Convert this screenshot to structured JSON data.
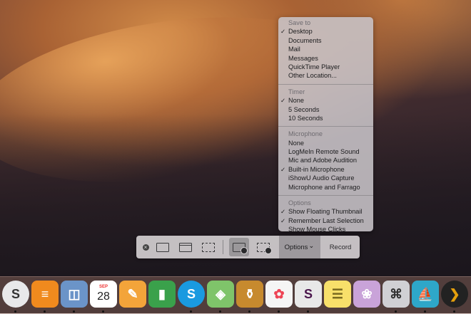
{
  "menu": {
    "sections": [
      {
        "header": "Save to",
        "items": [
          {
            "label": "Desktop",
            "checked": true
          },
          {
            "label": "Documents",
            "checked": false
          },
          {
            "label": "Mail",
            "checked": false
          },
          {
            "label": "Messages",
            "checked": false
          },
          {
            "label": "QuickTime Player",
            "checked": false
          },
          {
            "label": "Other Location...",
            "checked": false
          }
        ]
      },
      {
        "header": "Timer",
        "items": [
          {
            "label": "None",
            "checked": true
          },
          {
            "label": "5 Seconds",
            "checked": false
          },
          {
            "label": "10 Seconds",
            "checked": false
          }
        ]
      },
      {
        "header": "Microphone",
        "items": [
          {
            "label": "None",
            "checked": false
          },
          {
            "label": "LogMeIn Remote Sound",
            "checked": false
          },
          {
            "label": "Mic and Adobe Audition",
            "checked": false
          },
          {
            "label": "Built-in Microphone",
            "checked": true
          },
          {
            "label": "iShowU Audio Capture",
            "checked": false
          },
          {
            "label": "Microphone and Farrago",
            "checked": false
          }
        ]
      },
      {
        "header": "Options",
        "items": [
          {
            "label": "Show Floating Thumbnail",
            "checked": true
          },
          {
            "label": "Remember Last Selection",
            "checked": true
          },
          {
            "label": "Show Mouse Clicks",
            "checked": false
          }
        ]
      }
    ],
    "check_glyph": "✓"
  },
  "toolbar": {
    "close_glyph": "×",
    "options_label": "Options",
    "options_chevron": "⌄",
    "record_label": "Record"
  },
  "dock": {
    "apps": [
      {
        "name": "scrivener-icon",
        "glyph": "S",
        "color": "#e8e8ea",
        "fg": "#333",
        "dot": true
      },
      {
        "name": "omniplan-icon",
        "glyph": "≡",
        "color": "#f08a1e",
        "fg": "#fff",
        "dot": true
      },
      {
        "name": "preview-icon",
        "glyph": "◫",
        "color": "#6b94c8",
        "fg": "#fff",
        "dot": true
      },
      {
        "name": "calendar-icon",
        "glyph": "28",
        "color": "#ffffff",
        "fg": "#222",
        "dot": true,
        "month": "SEP"
      },
      {
        "name": "pages-icon",
        "glyph": "✎",
        "color": "#f3a43a",
        "fg": "#fff",
        "dot": false
      },
      {
        "name": "numbers-icon",
        "glyph": "▮",
        "color": "#3aa14b",
        "fg": "#fff",
        "dot": false
      },
      {
        "name": "skype-icon",
        "glyph": "S",
        "color": "#1a9ae0",
        "fg": "#fff",
        "dot": true
      },
      {
        "name": "maps-icon",
        "glyph": "◈",
        "color": "#7fc46a",
        "fg": "#fff",
        "dot": true
      },
      {
        "name": "jar-app-icon",
        "glyph": "⚱",
        "color": "#c78a2e",
        "fg": "#fff",
        "dot": true
      },
      {
        "name": "photos-icon",
        "glyph": "✿",
        "color": "#f5f5f5",
        "fg": "#e45",
        "dot": true
      },
      {
        "name": "slack-icon",
        "glyph": "S",
        "color": "#e8e8e8",
        "fg": "#4a154b",
        "dot": true
      },
      {
        "name": "notes-icon",
        "glyph": "☰",
        "color": "#f8e06a",
        "fg": "#7a6a20",
        "dot": false
      },
      {
        "name": "flower-app-icon",
        "glyph": "❀",
        "color": "#c9a3d9",
        "fg": "#fff",
        "dot": false
      },
      {
        "name": "system-tools-icon",
        "glyph": "⌘",
        "color": "#d0d0d4",
        "fg": "#333",
        "dot": true
      },
      {
        "name": "transmit-icon",
        "glyph": "⛵",
        "color": "#2ea7c9",
        "fg": "#fff",
        "dot": true
      },
      {
        "name": "plex-icon",
        "glyph": "❯",
        "color": "#222",
        "fg": "#e5a00d",
        "dot": true
      }
    ]
  }
}
